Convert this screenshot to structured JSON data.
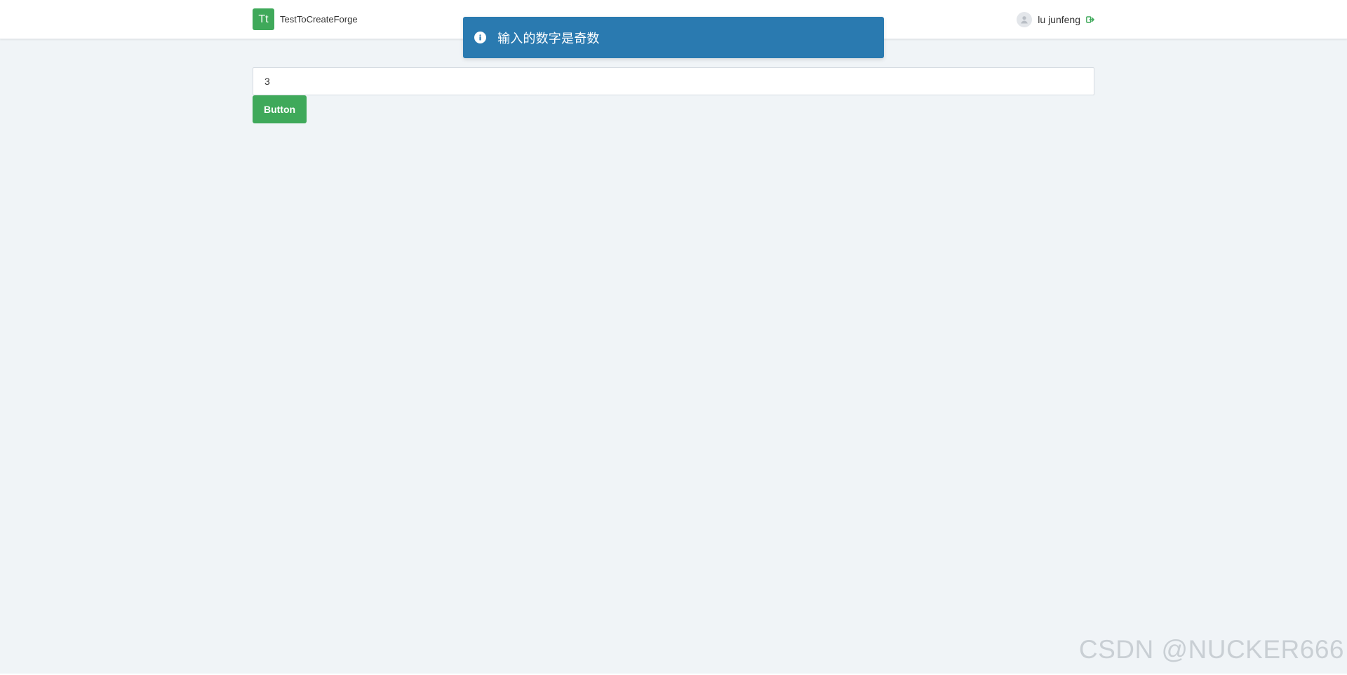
{
  "colors": {
    "brand_green": "#3fa95a",
    "button_green": "#3fa95a",
    "toast_blue": "#2a7ab0",
    "logout_green": "#3fa95a"
  },
  "header": {
    "logo_text": "Tt",
    "app_name": "TestToCreateForge",
    "user_name": "lu junfeng",
    "avatar_icon": "user-avatar-icon",
    "logout_icon": "logout-icon"
  },
  "toast": {
    "icon": "info-circle-icon",
    "message": "输入的数字是奇数"
  },
  "form": {
    "input_value": "3",
    "button_label": "Button"
  },
  "watermark": {
    "text": "CSDN @NUCKER666"
  }
}
